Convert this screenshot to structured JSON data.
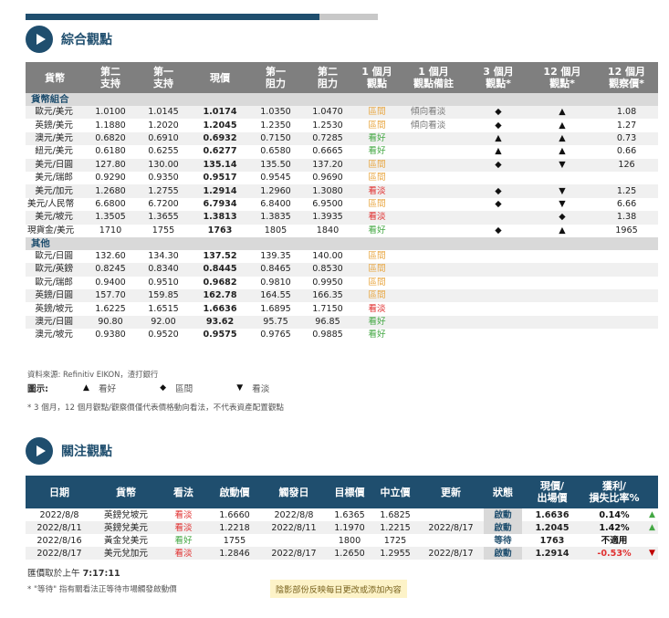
{
  "sec1": {
    "title": "綜合觀點"
  },
  "t1": {
    "headers": [
      "貨幣",
      "第二\n支持",
      "第一\n支持",
      "現價",
      "第一\n阻力",
      "第二\n阻力",
      "1 個月\n觀點",
      "1 個月\n觀點備註",
      "3 個月\n觀點*",
      "12 個月\n觀點*",
      "12 個月\n觀察價*"
    ],
    "groups": [
      "貨幣組合",
      "其他"
    ],
    "rows1": [
      {
        "n": "歐元/美元",
        "s2": "1.0100",
        "s1": "1.0145",
        "p": "1.0174",
        "r1": "1.0350",
        "r2": "1.0470",
        "v": "區間",
        "vc": "range",
        "note": "傾向看淡",
        "m3": "◆",
        "m12": "▲",
        "t12": "1.08"
      },
      {
        "n": "英鎊/美元",
        "s2": "1.1880",
        "s1": "1.2020",
        "p": "1.2045",
        "r1": "1.2350",
        "r2": "1.2530",
        "v": "區間",
        "vc": "range",
        "note": "傾向看淡",
        "m3": "◆",
        "m12": "▲",
        "t12": "1.27"
      },
      {
        "n": "澳元/美元",
        "s2": "0.6820",
        "s1": "0.6910",
        "p": "0.6932",
        "r1": "0.7150",
        "r2": "0.7285",
        "v": "看好",
        "vc": "buy",
        "note": "",
        "m3": "▲",
        "m12": "▲",
        "t12": "0.73"
      },
      {
        "n": "紐元/美元",
        "s2": "0.6180",
        "s1": "0.6255",
        "p": "0.6277",
        "r1": "0.6580",
        "r2": "0.6665",
        "v": "看好",
        "vc": "buy",
        "note": "",
        "m3": "▲",
        "m12": "▲",
        "t12": "0.66"
      },
      {
        "n": "美元/日圓",
        "s2": "127.80",
        "s1": "130.00",
        "p": "135.14",
        "r1": "135.50",
        "r2": "137.20",
        "v": "區間",
        "vc": "range",
        "note": "",
        "m3": "◆",
        "m12": "▼",
        "t12": "126"
      },
      {
        "n": "美元/瑞郎",
        "s2": "0.9290",
        "s1": "0.9350",
        "p": "0.9517",
        "r1": "0.9545",
        "r2": "0.9690",
        "v": "區間",
        "vc": "range",
        "note": "",
        "m3": "",
        "m12": "",
        "t12": ""
      },
      {
        "n": "美元/加元",
        "s2": "1.2680",
        "s1": "1.2755",
        "p": "1.2914",
        "r1": "1.2960",
        "r2": "1.3080",
        "v": "看淡",
        "vc": "sell",
        "note": "",
        "m3": "◆",
        "m12": "▼",
        "t12": "1.25"
      },
      {
        "n": "美元/人民幣",
        "s2": "6.6800",
        "s1": "6.7200",
        "p": "6.7934",
        "r1": "6.8400",
        "r2": "6.9500",
        "v": "區間",
        "vc": "range",
        "note": "",
        "m3": "◆",
        "m12": "▼",
        "t12": "6.66"
      },
      {
        "n": "美元/坡元",
        "s2": "1.3505",
        "s1": "1.3655",
        "p": "1.3813",
        "r1": "1.3835",
        "r2": "1.3935",
        "v": "看淡",
        "vc": "sell",
        "note": "",
        "m3": "",
        "m12": "◆",
        "t12": "1.38"
      },
      {
        "n": "現貨金/美元",
        "s2": "1710",
        "s1": "1755",
        "p": "1763",
        "r1": "1805",
        "r2": "1840",
        "v": "看好",
        "vc": "buy",
        "note": "",
        "m3": "◆",
        "m12": "▲",
        "t12": "1965"
      }
    ],
    "rows2": [
      {
        "n": "歐元/日圓",
        "s2": "132.60",
        "s1": "134.30",
        "p": "137.52",
        "r1": "139.35",
        "r2": "140.00",
        "v": "區間",
        "vc": "range"
      },
      {
        "n": "歐元/英鎊",
        "s2": "0.8245",
        "s1": "0.8340",
        "p": "0.8445",
        "r1": "0.8465",
        "r2": "0.8530",
        "v": "區間",
        "vc": "range"
      },
      {
        "n": "歐元/瑞郎",
        "s2": "0.9400",
        "s1": "0.9510",
        "p": "0.9682",
        "r1": "0.9810",
        "r2": "0.9950",
        "v": "區間",
        "vc": "range"
      },
      {
        "n": "英鎊/日圓",
        "s2": "157.70",
        "s1": "159.85",
        "p": "162.78",
        "r1": "164.55",
        "r2": "166.35",
        "v": "區間",
        "vc": "range"
      },
      {
        "n": "英鎊/坡元",
        "s2": "1.6225",
        "s1": "1.6515",
        "p": "1.6636",
        "r1": "1.6895",
        "r2": "1.7150",
        "v": "看淡",
        "vc": "sell"
      },
      {
        "n": "澳元/日圓",
        "s2": "90.80",
        "s1": "92.00",
        "p": "93.62",
        "r1": "95.75",
        "r2": "96.85",
        "v": "看好",
        "vc": "buy"
      },
      {
        "n": "澳元/坡元",
        "s2": "0.9380",
        "s1": "0.9520",
        "p": "0.9575",
        "r1": "0.9765",
        "r2": "0.9885",
        "v": "看好",
        "vc": "buy"
      }
    ]
  },
  "source": "資料來源: Refinitiv EIKON，渣打銀行",
  "legend": {
    "title": "圖示:",
    "items": [
      {
        "sym": "▲",
        "txt": "看好"
      },
      {
        "sym": "◆",
        "txt": "區間"
      },
      {
        "sym": "▼",
        "txt": "看淡"
      }
    ]
  },
  "note1": "* 3 個月，12 個月觀點/觀察價僅代表價格動向看法，不代表資產配置觀點",
  "sec2": {
    "title": "關注觀點"
  },
  "t2": {
    "headers": [
      "日期",
      "貨幣",
      "看法",
      "啟動價",
      "觸發日",
      "目標價",
      "中立價",
      "更新",
      "狀態",
      "現價/\n出場價",
      "獲利/\n損失比率%",
      ""
    ],
    "rows": [
      {
        "d": "2022/8/8",
        "c": "英鎊兌坡元",
        "v": "看淡",
        "vc": "sell",
        "ep": "1.6660",
        "td": "2022/8/8",
        "tp": "1.6365",
        "np": "1.6825",
        "u": "",
        "s": "啟動",
        "sg": true,
        "cp": "1.6636",
        "pl": "0.14%",
        "plc": "pos",
        "a": "▲",
        "ac": "up"
      },
      {
        "d": "2022/8/11",
        "c": "英鎊兌美元",
        "v": "看淡",
        "vc": "sell",
        "ep": "1.2218",
        "td": "2022/8/11",
        "tp": "1.1970",
        "np": "1.2215",
        "u": "2022/8/17",
        "s": "啟動",
        "sg": true,
        "cp": "1.2045",
        "pl": "1.42%",
        "plc": "pos",
        "a": "▲",
        "ac": "up"
      },
      {
        "d": "2022/8/16",
        "c": "黃金兌美元",
        "v": "看好",
        "vc": "buy",
        "ep": "1755",
        "td": "",
        "tp": "1800",
        "np": "1725",
        "u": "",
        "s": "等待",
        "sg": false,
        "cp": "1763",
        "pl": "不適用",
        "plc": "pos",
        "a": "",
        "ac": ""
      },
      {
        "d": "2022/8/17",
        "c": "美元兌加元",
        "v": "看淡",
        "vc": "sell",
        "ep": "1.2846",
        "td": "2022/8/17",
        "tp": "1.2650",
        "np": "1.2955",
        "u": "2022/8/17",
        "s": "啟動",
        "sg": true,
        "cp": "1.2914",
        "pl": "-0.53%",
        "plc": "neg",
        "a": "▼",
        "ac": "dn"
      }
    ]
  },
  "quote": {
    "label": "匯價取於上午",
    "time": "7:17:11"
  },
  "note2": "* \"等待\" 指有關看法正等待市場觸發啟動價",
  "shade_note": "陰影部份反映每日更改或添加內容",
  "colors": {
    "navy": "#1f4e6e",
    "buy": "#44a844",
    "sell": "#e03030",
    "range": "#e8a640",
    "header_gray": "#7f7f7f"
  }
}
